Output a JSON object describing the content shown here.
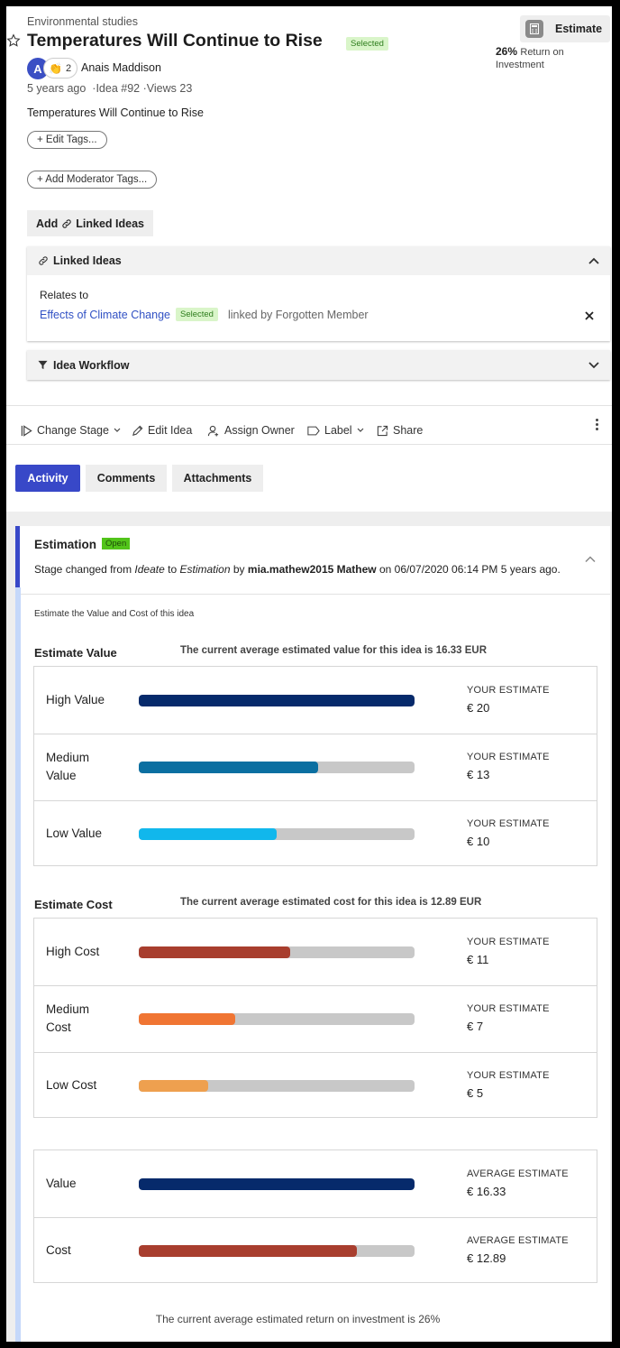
{
  "idea": {
    "category": "Environmental studies",
    "title": "Temperatures Will Continue to Rise",
    "status_badge": "Selected",
    "author_initial": "A",
    "reaction_count": "2",
    "author": "Anais Maddison",
    "age": "5 years ago",
    "idea_number": "Idea #92",
    "views": "Views 23",
    "description": "Temperatures Will Continue to Rise"
  },
  "estimate_box": {
    "button_label": "Estimate",
    "roi_value": "26%",
    "roi_label": "Return on Investment"
  },
  "tags": {
    "edit_tags": "+ Edit Tags...",
    "add_moderator_tags": "+ Add Moderator Tags...",
    "add_linked_ideas": "Add",
    "add_linked_ideas_suffix": "Linked Ideas"
  },
  "linked_ideas": {
    "header": "Linked Ideas",
    "relates_to": "Relates to",
    "link_title": "Effects of Climate Change",
    "link_badge": "Selected",
    "linked_by": "linked by Forgotten Member"
  },
  "workflow": {
    "header": "Idea Workflow"
  },
  "toolbar": {
    "change_stage": "Change Stage",
    "edit_idea": "Edit Idea",
    "assign_owner": "Assign Owner",
    "label": "Label",
    "share": "Share"
  },
  "tabs": {
    "activity": "Activity",
    "comments": "Comments",
    "attachments": "Attachments"
  },
  "estimation": {
    "title": "Estimation",
    "badge": "Open",
    "stage_prefix": "Stage changed from",
    "from_stage": "Ideate",
    "to_word": "to",
    "to_stage": "Estimation",
    "by_word": "by",
    "user": "mia.mathew2015 Mathew",
    "date_text": "on 06/07/2020 06:14 PM 5 years ago.",
    "instructions": "Estimate the Value and Cost of this idea"
  },
  "value_section": {
    "heading": "Estimate Value",
    "summary": "The current average estimated value for this idea is 16.33 EUR",
    "rows": [
      {
        "label_line1": "High Value",
        "label_line2": "",
        "estimate_label": "YOUR ESTIMATE",
        "estimate": "€ 20",
        "fraction": 1.0,
        "color": "#062a6b"
      },
      {
        "label_line1": "Medium",
        "label_line2": "Value",
        "estimate_label": "YOUR ESTIMATE",
        "estimate": "€ 13",
        "fraction": 0.65,
        "color": "#0b6fa1"
      },
      {
        "label_line1": "Low Value",
        "label_line2": "",
        "estimate_label": "YOUR ESTIMATE",
        "estimate": "€ 10",
        "fraction": 0.5,
        "color": "#11b7ec"
      }
    ]
  },
  "cost_section": {
    "heading": "Estimate Cost",
    "summary": "The current average estimated cost for this idea is 12.89 EUR",
    "rows": [
      {
        "label_line1": "High Cost",
        "label_line2": "",
        "estimate_label": "YOUR ESTIMATE",
        "estimate": "€ 11",
        "fraction": 0.55,
        "color": "#a83e2e"
      },
      {
        "label_line1": "Medium",
        "label_line2": "Cost",
        "estimate_label": "YOUR ESTIMATE",
        "estimate": "€ 7",
        "fraction": 0.35,
        "color": "#f07533"
      },
      {
        "label_line1": "Low Cost",
        "label_line2": "",
        "estimate_label": "YOUR ESTIMATE",
        "estimate": "€ 5",
        "fraction": 0.25,
        "color": "#eea04f"
      }
    ]
  },
  "average_section": {
    "rows": [
      {
        "label_line1": "Value",
        "label_line2": "",
        "estimate_label": "AVERAGE ESTIMATE",
        "estimate": "€ 16.33",
        "fraction": 1.0,
        "color": "#062a6b"
      },
      {
        "label_line1": "Cost",
        "label_line2": "",
        "estimate_label": "AVERAGE ESTIMATE",
        "estimate": "€ 12.89",
        "fraction": 0.79,
        "color": "#a83e2e"
      }
    ],
    "roi_statement": "The current average estimated return on investment is 26%"
  }
}
